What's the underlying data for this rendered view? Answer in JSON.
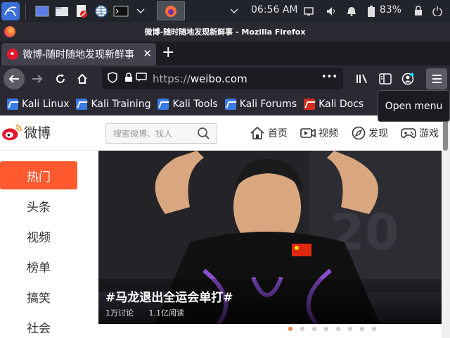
{
  "panel": {
    "clock": "06:56 AM",
    "battery": "83%",
    "icons": [
      "kali-menu-icon",
      "workspace-icon",
      "files-icon",
      "text-editor-icon",
      "browser-icon",
      "terminal-icon",
      "chevron-down-icon",
      "firefox-task-icon"
    ]
  },
  "window": {
    "title": "微博-随时随地发现新鲜事 - Mozilla Firefox"
  },
  "tab": {
    "title": "微博-随时随地发现新鲜事",
    "close": "✕",
    "new_tab": "+"
  },
  "urlbar": {
    "proto": "https://",
    "host": "weibo.com",
    "more": "•••"
  },
  "bookmarks": [
    {
      "label": "Kali Linux",
      "icon": "kali-icon"
    },
    {
      "label": "Kali Training",
      "icon": "kali-icon"
    },
    {
      "label": "Kali Tools",
      "icon": "kali-icon"
    },
    {
      "label": "Kali Forums",
      "icon": "kali-icon"
    },
    {
      "label": "Kali Docs",
      "icon": "exploit-db-icon"
    }
  ],
  "tooltip": "Open menu",
  "weibo": {
    "logo_text": "微博",
    "search_placeholder": "搜索微博、找人",
    "nav": [
      {
        "label": "首页",
        "icon": "home-icon"
      },
      {
        "label": "视频",
        "icon": "video-icon"
      },
      {
        "label": "发现",
        "icon": "compass-icon"
      },
      {
        "label": "游戏",
        "icon": "gamepad-icon"
      }
    ],
    "sidebar": [
      "热门",
      "头条",
      "视频",
      "榜单",
      "搞笑",
      "社会"
    ],
    "banner": {
      "headline": "#马龙退出全运会单打#",
      "discussions": "1万讨论",
      "reads": "1.1亿阅读"
    },
    "carousel_total": 8,
    "carousel_active": 0
  },
  "colors": {
    "accent": "#ff5a2f",
    "panel": "#21252b",
    "browser_chrome": "#2b2a33"
  }
}
